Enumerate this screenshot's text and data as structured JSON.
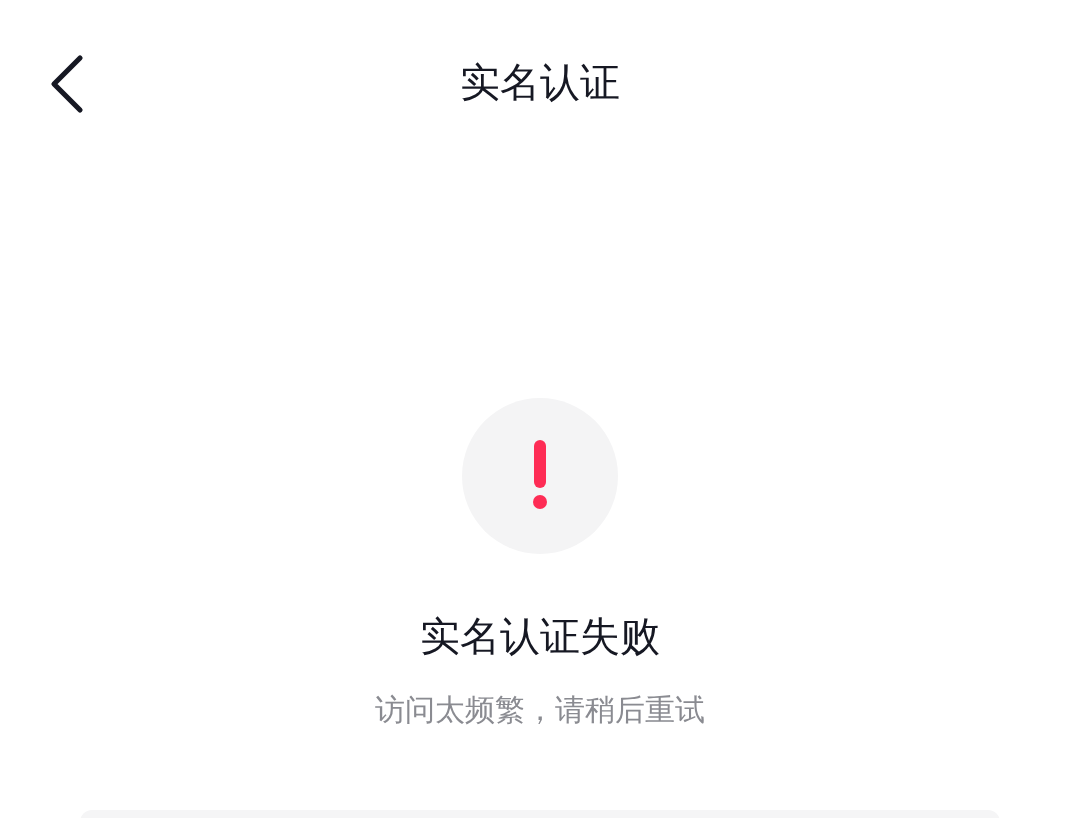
{
  "header": {
    "title": "实名认证"
  },
  "result": {
    "title": "实名认证失败",
    "message": "访问太频繁，请稍后重试"
  }
}
